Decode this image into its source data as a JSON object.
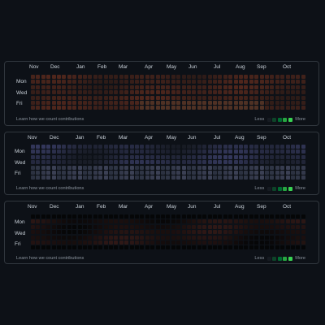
{
  "panels": [
    {
      "months": [
        "Nov",
        "Dec",
        "Jan",
        "Feb",
        "Mar",
        "Apr",
        "May",
        "Jun",
        "Jul",
        "Aug",
        "Sep",
        "Oct"
      ],
      "days": [
        "Mon",
        "Wed",
        "Fri"
      ],
      "footer_link": "Learn how we count contributions",
      "legend_less": "Less",
      "legend_more": "More",
      "theme": "warm"
    },
    {
      "months": [
        "Nov",
        "Dec",
        "Jan",
        "Feb",
        "Mar",
        "Apr",
        "May",
        "Jun",
        "Jul",
        "Aug",
        "Sep",
        "Oct"
      ],
      "days": [
        "Mon",
        "Wed",
        "Fri"
      ],
      "footer_link": "Learn how we count contributions",
      "legend_less": "Less",
      "legend_more": "More",
      "theme": "cool"
    },
    {
      "months": [
        "Nov",
        "Dec",
        "Jan",
        "Feb",
        "Mar",
        "Apr",
        "May",
        "Jun",
        "Jul",
        "Aug",
        "Sep",
        "Oct"
      ],
      "days": [
        "Mon",
        "Wed",
        "Fri"
      ],
      "footer_link": "Learn how we count contributions",
      "legend_less": "Less",
      "legend_more": "More",
      "theme": "dark"
    }
  ],
  "legend_colors": [
    "#161b22",
    "#0e4429",
    "#006d32",
    "#26a641",
    "#39d353"
  ],
  "themes": {
    "warm": {
      "base": "#2a1a17",
      "hi": "#5a2a1e",
      "mid": "#3d2b25"
    },
    "cool": {
      "base": "#161a22",
      "hi": "#3b3f6a",
      "mid": "#2b3140"
    },
    "dark": {
      "base": "#050607",
      "hi": "#3a1d1a",
      "mid": "#101214"
    }
  }
}
